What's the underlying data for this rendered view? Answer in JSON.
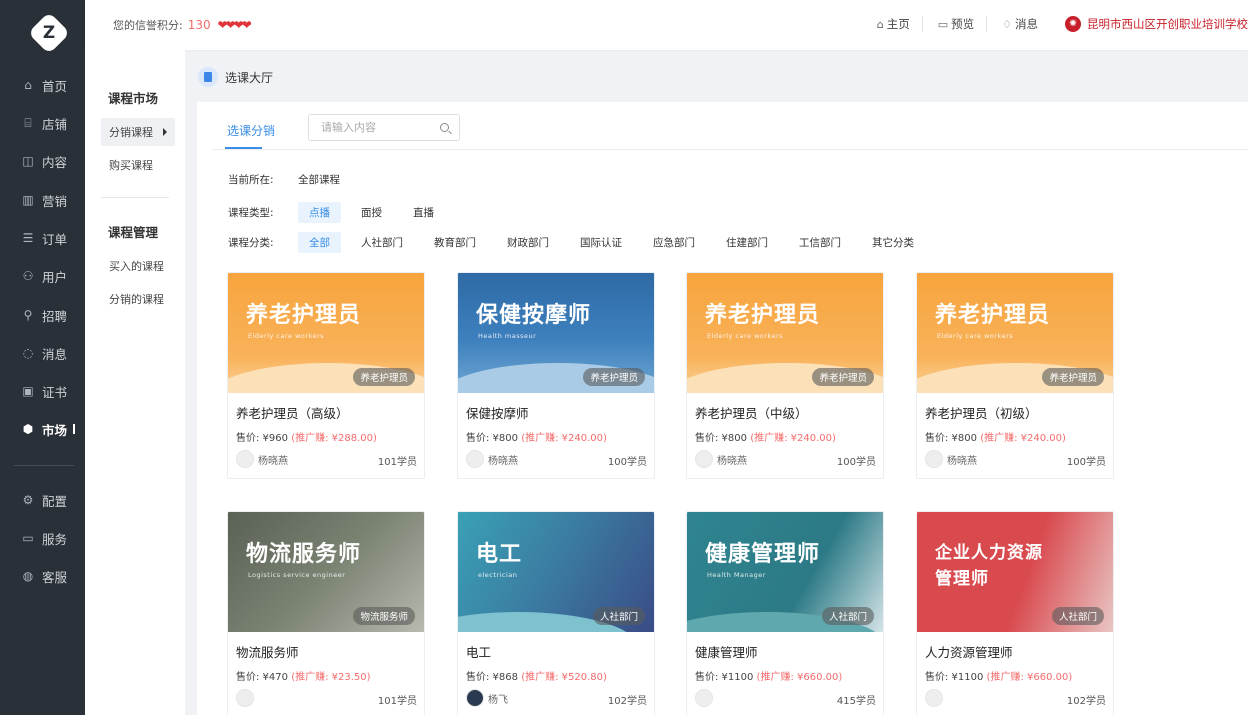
{
  "sidebar": {
    "items": [
      {
        "label": "首页",
        "icon": "home-icon",
        "glyph": "⌂"
      },
      {
        "label": "店铺",
        "icon": "shop-icon",
        "glyph": "⌸"
      },
      {
        "label": "内容",
        "icon": "content-icon",
        "glyph": "◫"
      },
      {
        "label": "营销",
        "icon": "marketing-icon",
        "glyph": "▥"
      },
      {
        "label": "订单",
        "icon": "order-icon",
        "glyph": "☰"
      },
      {
        "label": "用户",
        "icon": "user-icon",
        "glyph": "⚇"
      },
      {
        "label": "招聘",
        "icon": "recruit-icon",
        "glyph": "⚲"
      },
      {
        "label": "消息",
        "icon": "message-icon",
        "glyph": "◌"
      },
      {
        "label": "证书",
        "icon": "certificate-icon",
        "glyph": "▣"
      },
      {
        "label": "市场",
        "icon": "market-icon",
        "glyph": "⬢"
      },
      {
        "label": "配置",
        "icon": "settings-icon",
        "glyph": "⚙"
      },
      {
        "label": "服务",
        "icon": "service-icon",
        "glyph": "▭"
      },
      {
        "label": "客服",
        "icon": "support-icon",
        "glyph": "◍"
      }
    ],
    "active": "市场"
  },
  "header": {
    "credit_label": "您的信誉积分:",
    "credit_value": "130",
    "hearts": "❤❤❤❤",
    "links": [
      {
        "label": "主页",
        "icon": "home-icon",
        "glyph": "⌂"
      },
      {
        "label": "预览",
        "icon": "monitor-icon",
        "glyph": "▭"
      },
      {
        "label": "消息",
        "icon": "bell-icon",
        "glyph": "♢"
      }
    ],
    "org_name": "昆明市西山区开创职业培训学校"
  },
  "subnav": {
    "section1_title": "课程市场",
    "section1_items": [
      "分销课程",
      "购买课程"
    ],
    "section2_title": "课程管理",
    "section2_items": [
      "买入的课程",
      "分销的课程"
    ]
  },
  "breadcrumb": "选课大厅",
  "tabs": {
    "active": "选课分销"
  },
  "search": {
    "placeholder": "请输入内容"
  },
  "filters": {
    "location_label": "当前所在:",
    "location_value": "全部课程",
    "type_label": "课程类型:",
    "types": [
      "点播",
      "面授",
      "直播"
    ],
    "category_label": "课程分类:",
    "categories": [
      "全部",
      "人社部门",
      "教育部门",
      "财政部门",
      "国际认证",
      "应急部门",
      "住建部门",
      "工信部门",
      "其它分类"
    ]
  },
  "courses": [
    {
      "cover_title": "养老护理员",
      "cover_sub": "Elderly care workers",
      "tag": "养老护理员",
      "name": "养老护理员（高级）",
      "price": "售价: ¥960",
      "promo": "(推广赚: ¥288.00)",
      "teacher": "杨晓燕",
      "students": "101学员"
    },
    {
      "cover_title": "保健按摩师",
      "cover_sub": "Health masseur",
      "tag": "养老护理员",
      "name": "保健按摩师",
      "price": "售价: ¥800",
      "promo": "(推广赚: ¥240.00)",
      "teacher": "杨晓燕",
      "students": "100学员"
    },
    {
      "cover_title": "养老护理员",
      "cover_sub": "Elderly care workers",
      "tag": "养老护理员",
      "name": "养老护理员（中级）",
      "price": "售价: ¥800",
      "promo": "(推广赚: ¥240.00)",
      "teacher": "杨晓燕",
      "students": "100学员"
    },
    {
      "cover_title": "养老护理员",
      "cover_sub": "Elderly care workers",
      "tag": "养老护理员",
      "name": "养老护理员（初级）",
      "price": "售价: ¥800",
      "promo": "(推广赚: ¥240.00)",
      "teacher": "杨晓燕",
      "students": "100学员"
    },
    {
      "cover_title": "物流服务师",
      "cover_sub": "Logistics service engineer",
      "tag": "物流服务师",
      "name": "物流服务师",
      "price": "售价: ¥470",
      "promo": "(推广赚: ¥23.50)",
      "teacher": "",
      "students": "101学员"
    },
    {
      "cover_title": "电工",
      "cover_sub": "electrician",
      "tag": "人社部门",
      "name": "电工",
      "price": "售价: ¥868",
      "promo": "(推广赚: ¥520.80)",
      "teacher": "杨飞",
      "students": "102学员"
    },
    {
      "cover_title": "健康管理师",
      "cover_sub": "Health Manager",
      "tag": "人社部门",
      "name": "健康管理师",
      "price": "售价: ¥1100",
      "promo": "(推广赚: ¥660.00)",
      "teacher": "",
      "students": "415学员"
    },
    {
      "cover_title": "企业人力资源管理师",
      "cover_sub": "",
      "tag": "人社部门",
      "name": "人力资源管理师",
      "price": "售价: ¥1100",
      "promo": "(推广赚: ¥660.00)",
      "teacher": "",
      "students": "102学员"
    }
  ]
}
